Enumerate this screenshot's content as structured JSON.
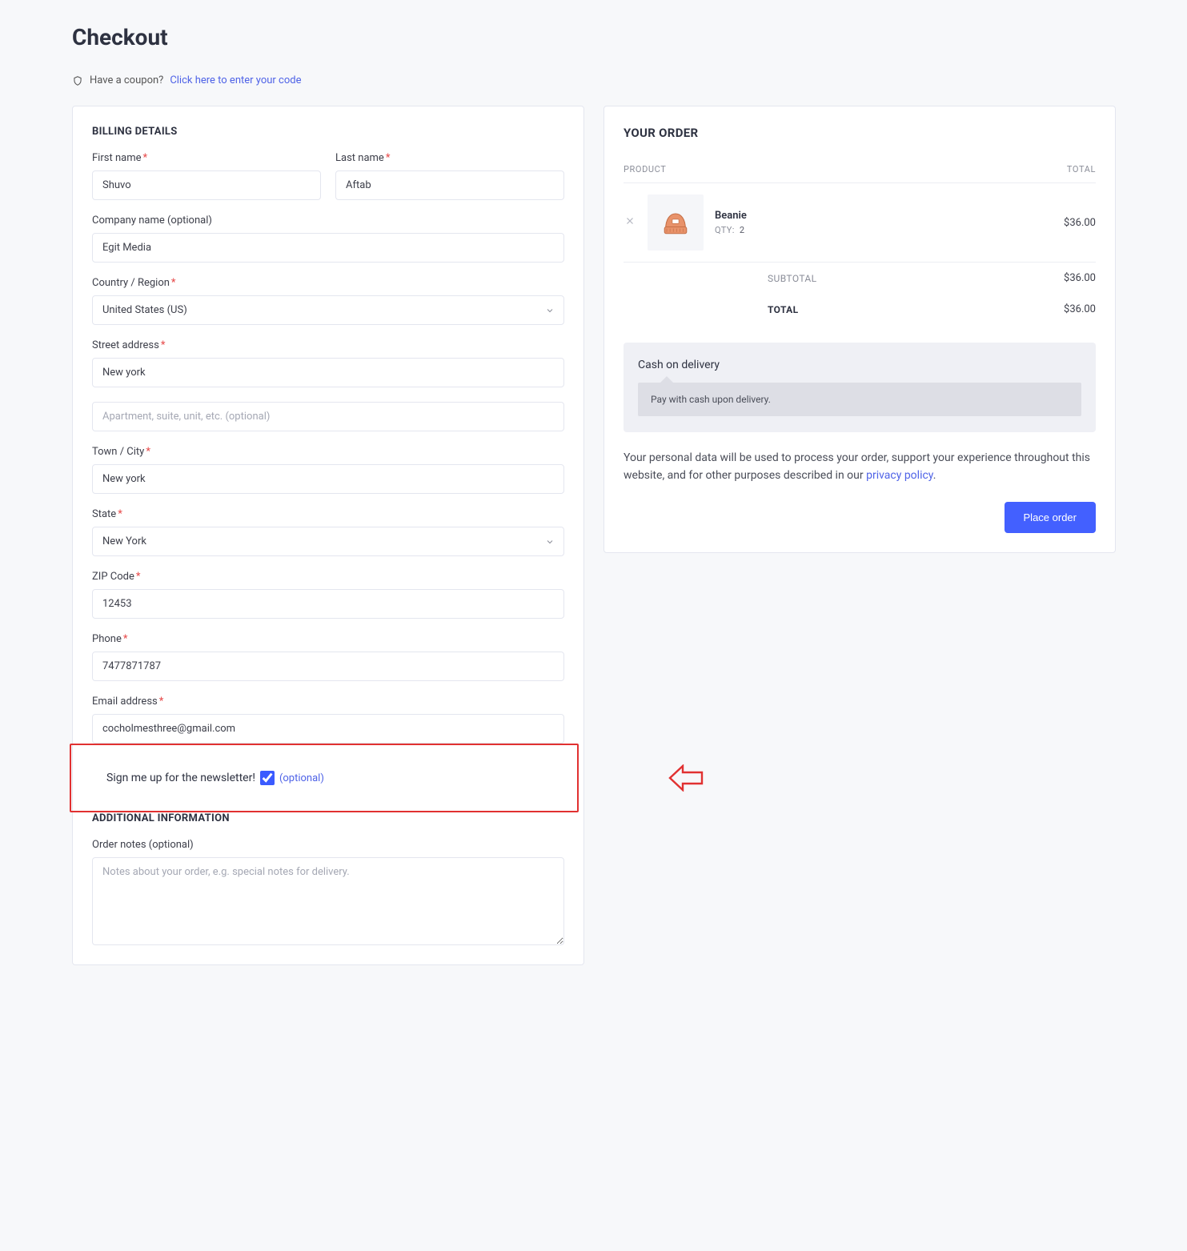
{
  "pageTitle": "Checkout",
  "coupon": {
    "prompt": "Have a coupon?",
    "link": "Click here to enter your code"
  },
  "billing": {
    "heading": "BILLING DETAILS",
    "firstNameLabel": "First name",
    "firstNameValue": "Shuvo",
    "lastNameLabel": "Last name",
    "lastNameValue": "Aftab",
    "companyLabel": "Company name (optional)",
    "companyValue": "Egit Media",
    "countryLabel": "Country / Region",
    "countryValue": "United States (US)",
    "streetLabel": "Street address",
    "streetValue": "New york",
    "street2Placeholder": "Apartment, suite, unit, etc. (optional)",
    "street2Value": "",
    "cityLabel": "Town / City",
    "cityValue": "New york",
    "stateLabel": "State",
    "stateValue": "New York",
    "zipLabel": "ZIP Code",
    "zipValue": "12453",
    "phoneLabel": "Phone",
    "phoneValue": "7477871787",
    "emailLabel": "Email address",
    "emailValue": "cocholmesthree@gmail.com"
  },
  "newsletter": {
    "label": "Sign me up for the newsletter!",
    "optional": "(optional)",
    "checked": true
  },
  "additional": {
    "heading": "ADDITIONAL INFORMATION",
    "notesLabel": "Order notes (optional)",
    "notesPlaceholder": "Notes about your order, e.g. special notes for delivery.",
    "notesValue": ""
  },
  "order": {
    "heading": "YOUR ORDER",
    "colProduct": "PRODUCT",
    "colTotal": "TOTAL",
    "items": [
      {
        "name": "Beanie",
        "qtyLabel": "QTY:",
        "qty": "2",
        "price": "$36.00"
      }
    ],
    "subtotalLabel": "SUBTOTAL",
    "subtotalValue": "$36.00",
    "totalLabel": "TOTAL",
    "totalValue": "$36.00"
  },
  "payment": {
    "title": "Cash on delivery",
    "desc": "Pay with cash upon delivery."
  },
  "privacy": {
    "text1": "Your personal data will be used to process your order, support your experience throughout this website, and for other purposes described in our ",
    "linkText": "privacy policy",
    "text2": "."
  },
  "placeOrder": "Place order"
}
